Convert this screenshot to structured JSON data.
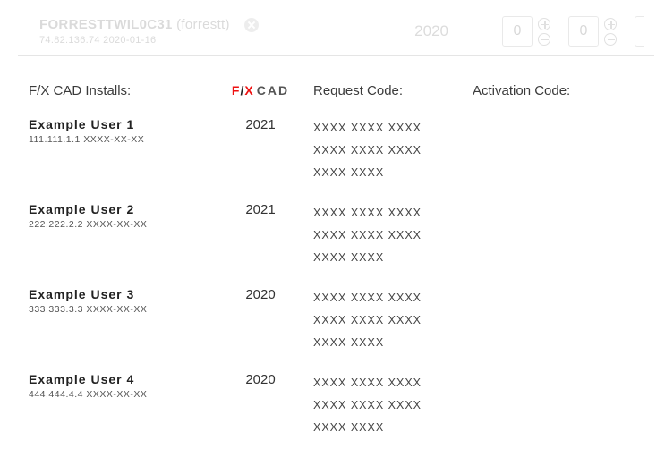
{
  "top": {
    "title_main": "FORRESTTWIL0C31",
    "title_paren": "(forrestt)",
    "sub": "74.82.136.74 2020-01-16",
    "year": "2020",
    "counter1": "0",
    "counter2": "0"
  },
  "headers": {
    "installs": "F/X CAD Installs:",
    "request": "Request Code:",
    "activation": "Activation Code:"
  },
  "logo": {
    "f": "F",
    "slash": "/",
    "x": "X",
    "cad": "CAD"
  },
  "users": [
    {
      "name": "Example User 1",
      "meta": "111.111.1.1 XXXX-XX-XX",
      "year": "2021",
      "req1": "XXXX  XXXX  XXXX",
      "req2": "XXXX  XXXX  XXXX",
      "req3": "XXXX  XXXX"
    },
    {
      "name": "Example User 2",
      "meta": "222.222.2.2 XXXX-XX-XX",
      "year": "2021",
      "req1": "XXXX  XXXX  XXXX",
      "req2": "XXXX  XXXX  XXXX",
      "req3": "XXXX  XXXX"
    },
    {
      "name": "Example User 3",
      "meta": "333.333.3.3 XXXX-XX-XX",
      "year": "2020",
      "req1": "XXXX  XXXX  XXXX",
      "req2": "XXXX  XXXX  XXXX",
      "req3": "XXXX  XXXX"
    },
    {
      "name": "Example User 4",
      "meta": "444.444.4.4 XXXX-XX-XX",
      "year": "2020",
      "req1": "XXXX  XXXX  XXXX",
      "req2": "XXXX  XXXX  XXXX",
      "req3": "XXXX  XXXX"
    }
  ]
}
